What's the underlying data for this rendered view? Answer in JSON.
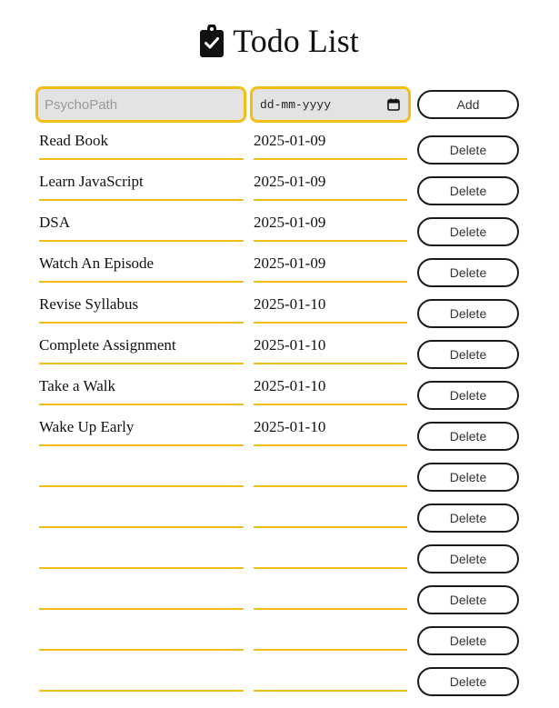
{
  "header": {
    "title": "Todo List",
    "icon": "clipboard-check-icon"
  },
  "form": {
    "task_placeholder": "PsychoPath",
    "date_placeholder": "dd-mm-yyyy",
    "add_label": "Add"
  },
  "colors": {
    "accent": "#f5bd12",
    "input_bg": "#e3e3e3",
    "button_border": "#1a1a1a"
  },
  "todos": [
    {
      "name": "Read Book",
      "date": "2025-01-09",
      "delete_label": "Delete"
    },
    {
      "name": "Learn JavaScript",
      "date": "2025-01-09",
      "delete_label": "Delete"
    },
    {
      "name": "DSA",
      "date": "2025-01-09",
      "delete_label": "Delete"
    },
    {
      "name": "Watch An Episode",
      "date": "2025-01-09",
      "delete_label": "Delete"
    },
    {
      "name": "Revise Syllabus",
      "date": "2025-01-10",
      "delete_label": "Delete"
    },
    {
      "name": "Complete Assignment",
      "date": "2025-01-10",
      "delete_label": "Delete"
    },
    {
      "name": "Take a Walk",
      "date": "2025-01-10",
      "delete_label": "Delete"
    },
    {
      "name": "Wake Up Early",
      "date": "2025-01-10",
      "delete_label": "Delete"
    },
    {
      "name": "",
      "date": "",
      "delete_label": "Delete"
    },
    {
      "name": "",
      "date": "",
      "delete_label": "Delete"
    },
    {
      "name": "",
      "date": "",
      "delete_label": "Delete"
    },
    {
      "name": "",
      "date": "",
      "delete_label": "Delete"
    },
    {
      "name": "",
      "date": "",
      "delete_label": "Delete"
    },
    {
      "name": "",
      "date": "",
      "delete_label": "Delete"
    }
  ]
}
